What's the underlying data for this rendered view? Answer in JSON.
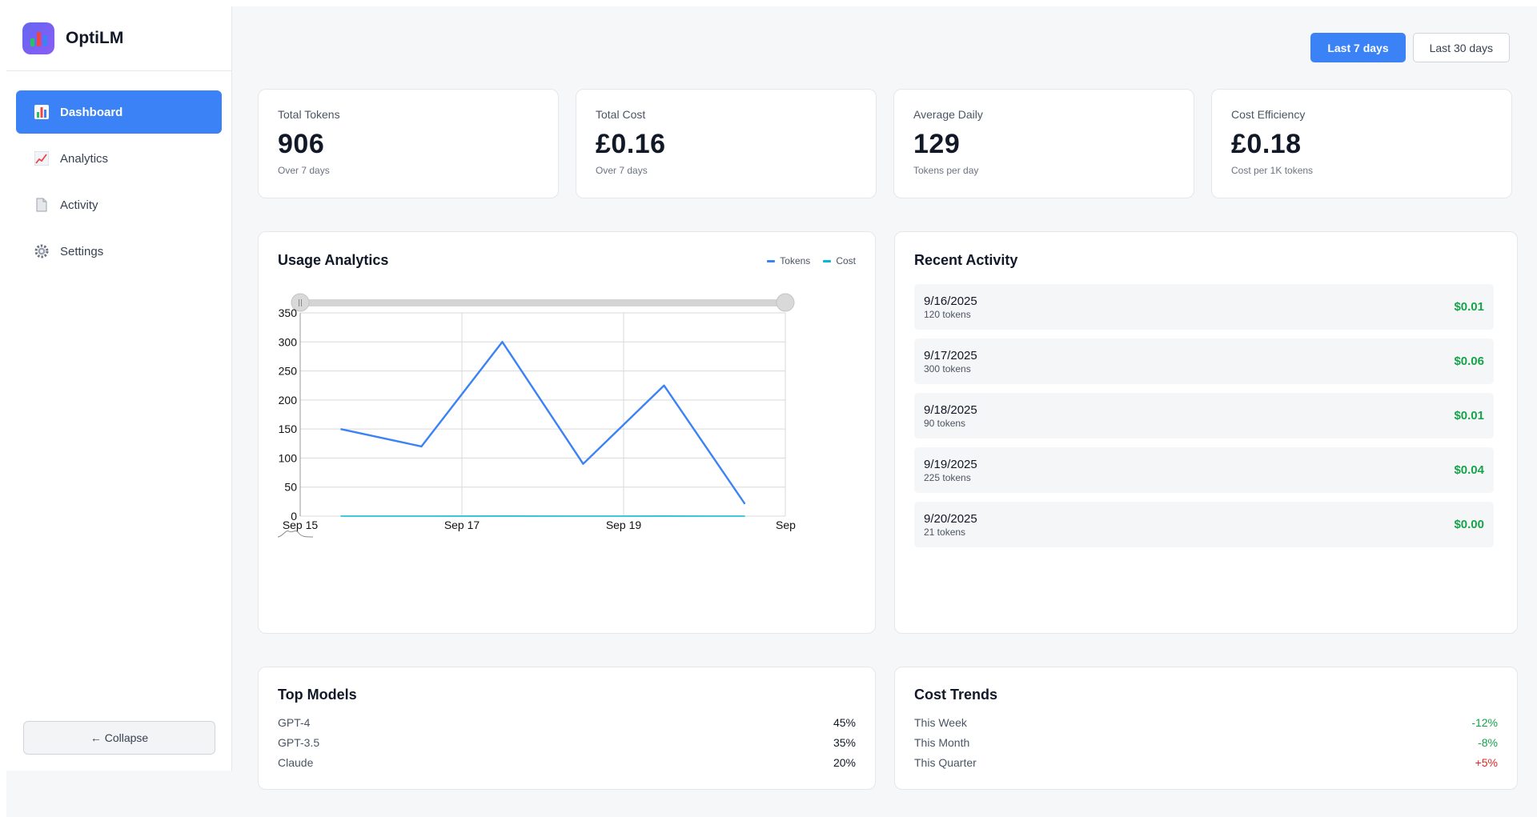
{
  "brand": {
    "name": "OptiLM"
  },
  "nav": {
    "items": [
      {
        "label": "Dashboard",
        "icon": "bar-chart-icon"
      },
      {
        "label": "Analytics",
        "icon": "trend-chart-icon"
      },
      {
        "label": "Activity",
        "icon": "document-icon"
      },
      {
        "label": "Settings",
        "icon": "gear-icon"
      }
    ],
    "active": "Dashboard",
    "collapse_label": "← Collapse"
  },
  "range": {
    "options": [
      "Last 7 days",
      "Last 30 days"
    ],
    "selected": "Last 7 days"
  },
  "stats": [
    {
      "label": "Total Tokens",
      "value": "906",
      "sub": "Over 7 days"
    },
    {
      "label": "Total Cost",
      "value": "£0.16",
      "sub": "Over 7 days"
    },
    {
      "label": "Average Daily",
      "value": "129",
      "sub": "Tokens per day"
    },
    {
      "label": "Cost Efficiency",
      "value": "£0.18",
      "sub": "Cost per 1K tokens"
    }
  ],
  "usage": {
    "title": "Usage Analytics",
    "legend": [
      {
        "name": "Tokens",
        "color": "#3b82f6"
      },
      {
        "name": "Cost",
        "color": "#06b6d4"
      }
    ]
  },
  "chart_data": {
    "type": "line",
    "x": [
      "Sep 15.5",
      "Sep 16",
      "Sep 17",
      "Sep 18",
      "Sep 19",
      "Sep 20"
    ],
    "x_tick_labels": [
      "Sep 15",
      "Sep 17",
      "Sep 19",
      "Sep"
    ],
    "series": [
      {
        "name": "Tokens",
        "color": "#3b82f6",
        "values": [
          150,
          120,
          300,
          90,
          225,
          21
        ]
      },
      {
        "name": "Cost",
        "color": "#06b6d4",
        "values": [
          0.01,
          0.01,
          0.06,
          0.01,
          0.04,
          0.0
        ]
      }
    ],
    "ylim": [
      0,
      350
    ],
    "y_ticks": [
      0,
      50,
      100,
      150,
      200,
      250,
      300,
      350
    ],
    "grid": true,
    "legend": "top-right",
    "range_slider": true
  },
  "activity": {
    "title": "Recent Activity",
    "items": [
      {
        "date": "9/16/2025",
        "tokens": "120 tokens",
        "cost": "$0.01"
      },
      {
        "date": "9/17/2025",
        "tokens": "300 tokens",
        "cost": "$0.06"
      },
      {
        "date": "9/18/2025",
        "tokens": "90 tokens",
        "cost": "$0.01"
      },
      {
        "date": "9/19/2025",
        "tokens": "225 tokens",
        "cost": "$0.04"
      },
      {
        "date": "9/20/2025",
        "tokens": "21 tokens",
        "cost": "$0.00"
      }
    ]
  },
  "models": {
    "title": "Top Models",
    "rows": [
      {
        "name": "GPT-4",
        "value": "45%"
      },
      {
        "name": "GPT-3.5",
        "value": "35%"
      },
      {
        "name": "Claude",
        "value": "20%"
      }
    ]
  },
  "trends": {
    "title": "Cost Trends",
    "rows": [
      {
        "name": "This Week",
        "value": "-12%",
        "status": "good"
      },
      {
        "name": "This Month",
        "value": "-8%",
        "status": "good"
      },
      {
        "name": "This Quarter",
        "value": "+5%",
        "status": "bad"
      }
    ]
  },
  "colors": {
    "accent": "#3b82f6",
    "positive": "#16a34a",
    "negative": "#dc2626"
  }
}
